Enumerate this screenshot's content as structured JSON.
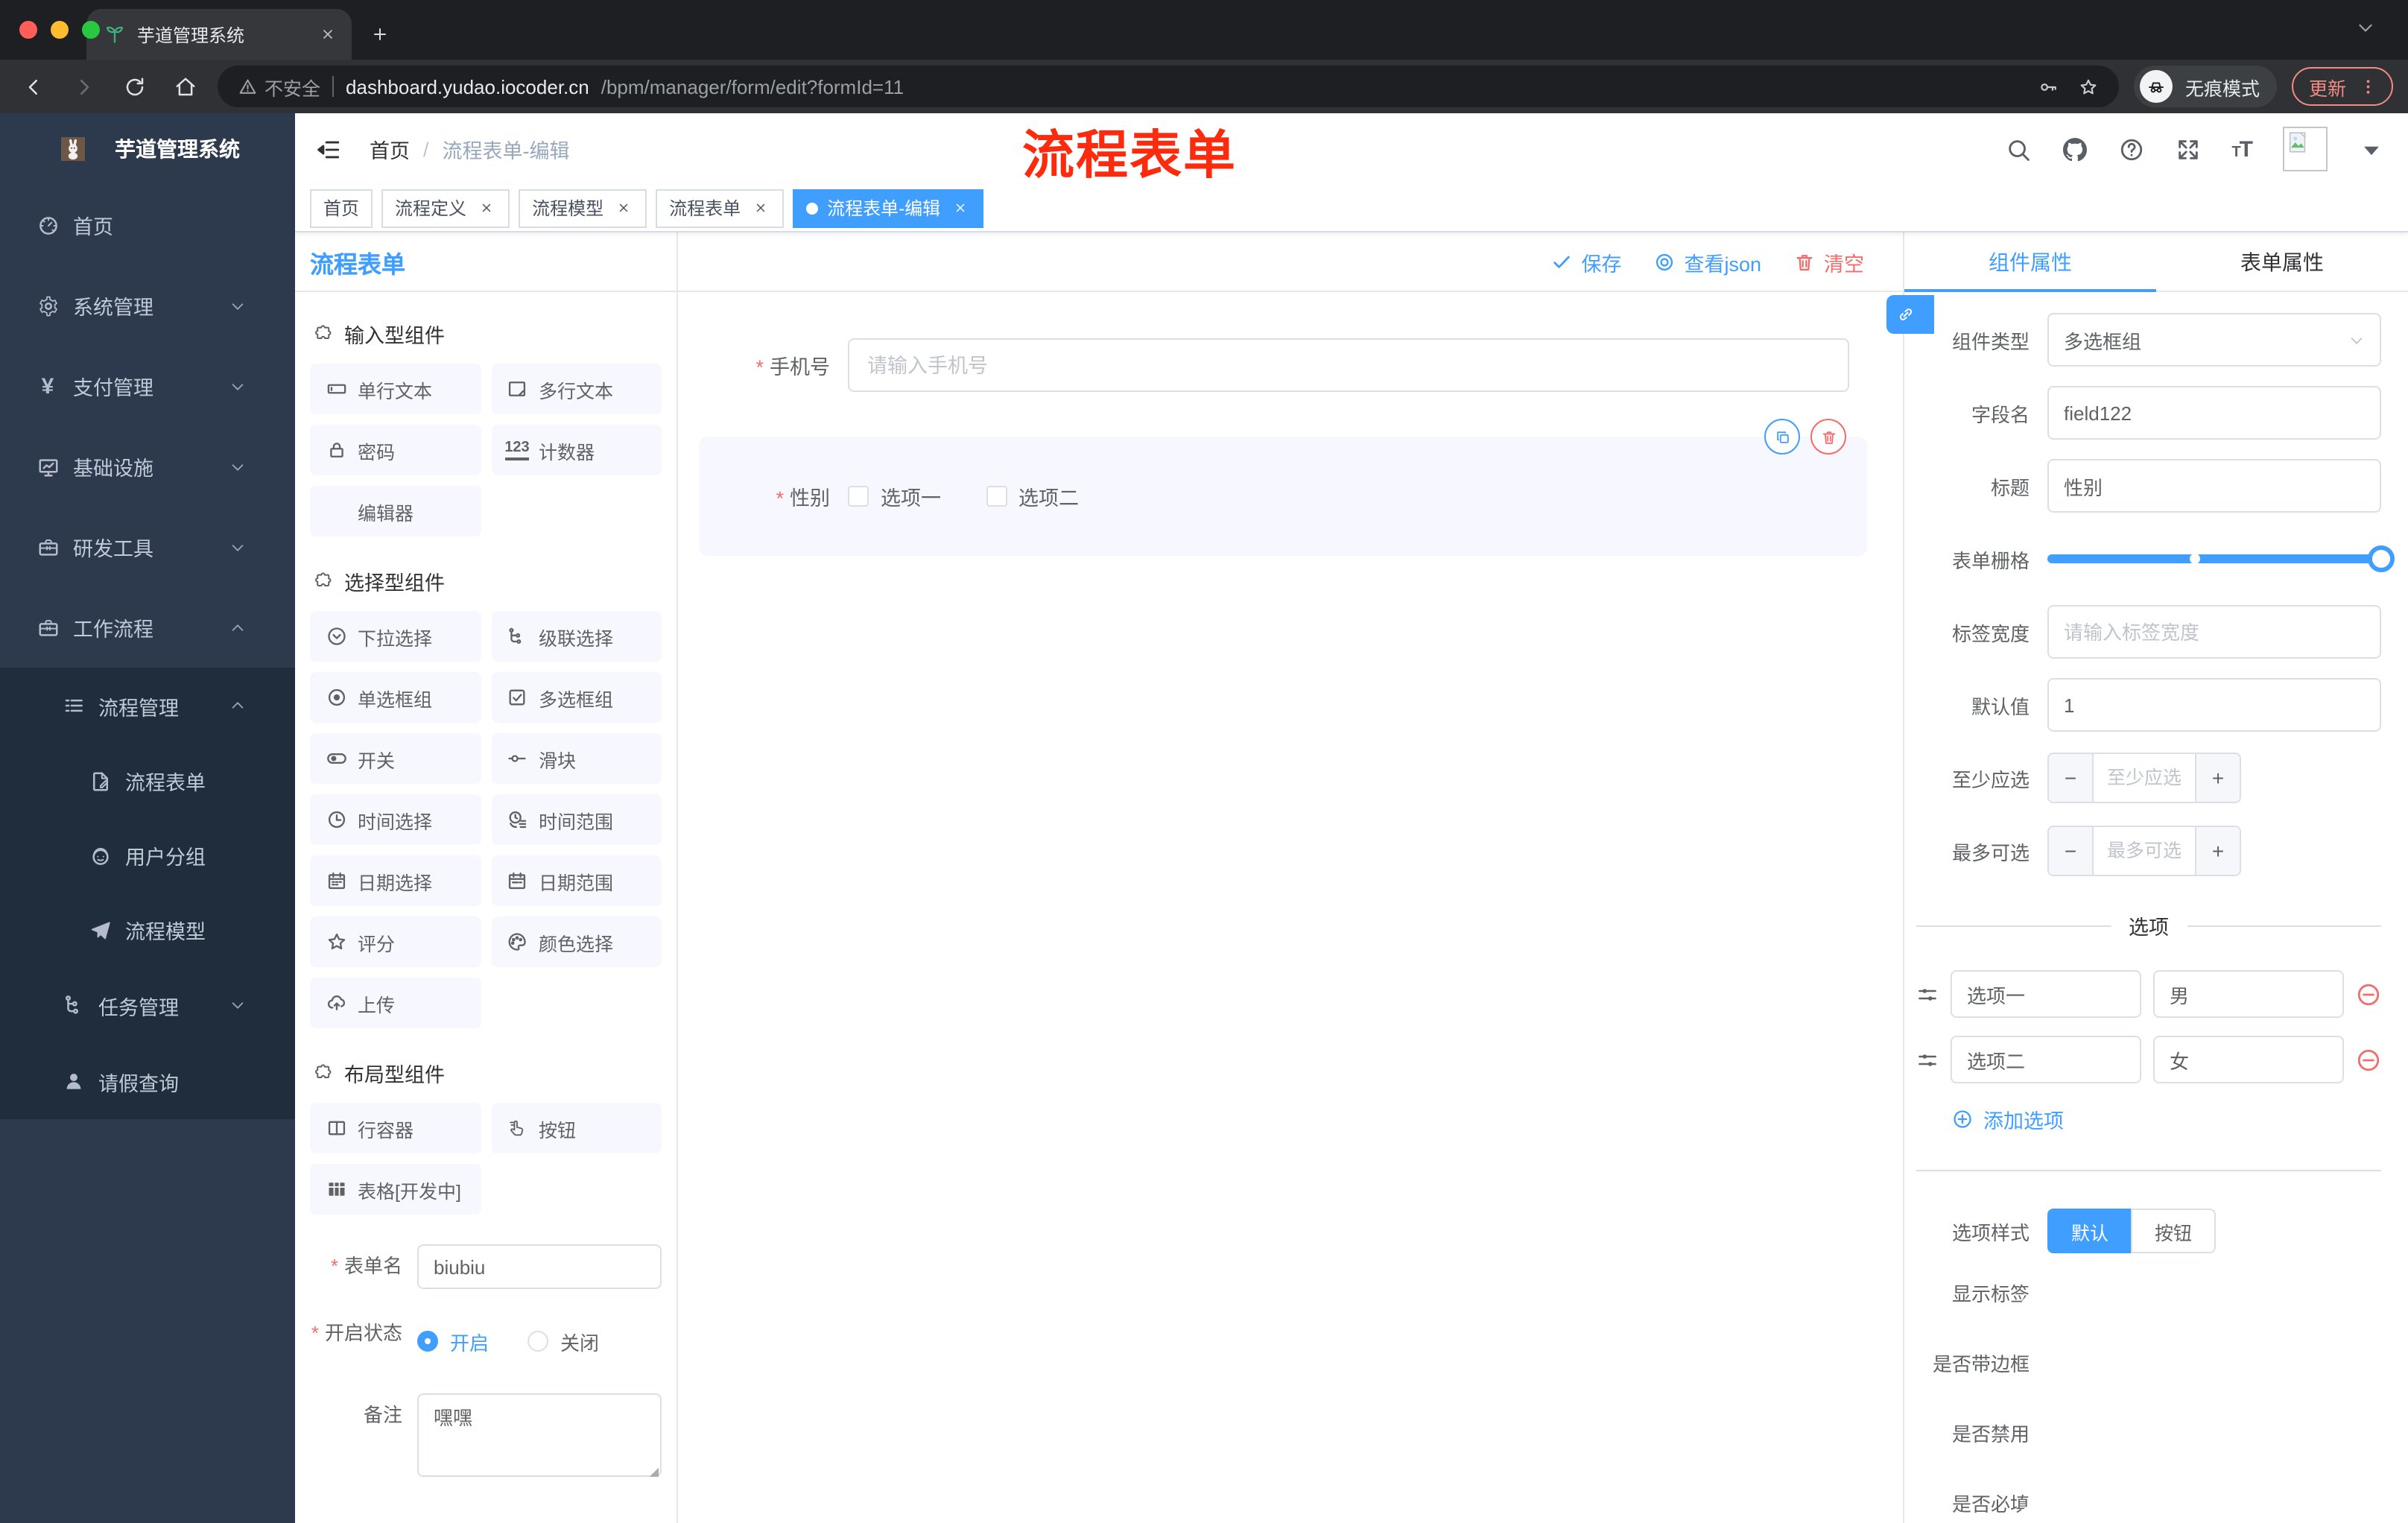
{
  "colors": {
    "primary": "#409eff",
    "danger": "#f56c6c",
    "annotation_red": "#fd2b0e",
    "sidebar_bg": "#2d3a4d",
    "submenu_bg": "#1f2d3d"
  },
  "browser": {
    "tab_title": "芋道管理系统",
    "security_label": "不安全",
    "url_domain": "dashboard.yudao.iocoder.cn",
    "url_path": "/bpm/manager/form/edit?formId=11",
    "incognito_label": "无痕模式",
    "update_label": "更新"
  },
  "sidebar": {
    "logo_title": "芋道管理系统",
    "items": [
      {
        "label": "首页",
        "icon": "dashboard-icon",
        "depth": 0,
        "chevron": ""
      },
      {
        "label": "系统管理",
        "icon": "gear-icon",
        "depth": 0,
        "chevron": "down"
      },
      {
        "label": "支付管理",
        "icon": "yen-icon",
        "depth": 0,
        "chevron": "down"
      },
      {
        "label": "基础设施",
        "icon": "monitor-icon",
        "depth": 0,
        "chevron": "down"
      },
      {
        "label": "研发工具",
        "icon": "briefcase-icon",
        "depth": 0,
        "chevron": "down"
      },
      {
        "label": "工作流程",
        "icon": "briefcase-icon",
        "depth": 0,
        "chevron": "up"
      },
      {
        "label": "流程管理",
        "icon": "list-icon",
        "depth": 1,
        "chevron": "up"
      },
      {
        "label": "流程表单",
        "icon": "doc-edit-icon",
        "depth": 2,
        "chevron": ""
      },
      {
        "label": "用户分组",
        "icon": "face-icon",
        "depth": 2,
        "chevron": ""
      },
      {
        "label": "流程模型",
        "icon": "send-icon",
        "depth": 2,
        "chevron": ""
      },
      {
        "label": "任务管理",
        "icon": "tree-icon",
        "depth": 1,
        "chevron": "down"
      },
      {
        "label": "请假查询",
        "icon": "user-icon",
        "depth": 1,
        "chevron": ""
      }
    ]
  },
  "navbar": {
    "breadcrumb": [
      "首页",
      "流程表单-编辑"
    ],
    "annotation": "流程表单"
  },
  "tags": [
    {
      "label": "首页",
      "closable": false,
      "active": false
    },
    {
      "label": "流程定义",
      "closable": true,
      "active": false
    },
    {
      "label": "流程模型",
      "closable": true,
      "active": false
    },
    {
      "label": "流程表单",
      "closable": true,
      "active": false
    },
    {
      "label": "流程表单-编辑",
      "closable": true,
      "active": true
    }
  ],
  "components_panel": {
    "title": "流程表单",
    "groups": [
      {
        "title": "输入型组件",
        "items": [
          {
            "label": "单行文本",
            "icon": "input-icon"
          },
          {
            "label": "多行文本",
            "icon": "textarea-icon"
          },
          {
            "label": "密码",
            "icon": "lock-icon"
          },
          {
            "label": "计数器",
            "icon": "counter-icon"
          },
          {
            "label": "编辑器",
            "icon": ""
          }
        ]
      },
      {
        "title": "选择型组件",
        "items": [
          {
            "label": "下拉选择",
            "icon": "select-icon"
          },
          {
            "label": "级联选择",
            "icon": "cascade-icon"
          },
          {
            "label": "单选框组",
            "icon": "radio-icon"
          },
          {
            "label": "多选框组",
            "icon": "checkbox-icon"
          },
          {
            "label": "开关",
            "icon": "switch-icon"
          },
          {
            "label": "滑块",
            "icon": "slider-icon"
          },
          {
            "label": "时间选择",
            "icon": "clock-icon"
          },
          {
            "label": "时间范围",
            "icon": "clock-range-icon"
          },
          {
            "label": "日期选择",
            "icon": "calendar-icon"
          },
          {
            "label": "日期范围",
            "icon": "calendar-range-icon"
          },
          {
            "label": "评分",
            "icon": "star-icon"
          },
          {
            "label": "颜色选择",
            "icon": "palette-icon"
          },
          {
            "label": "上传",
            "icon": "cloud-upload-icon"
          }
        ]
      },
      {
        "title": "布局型组件",
        "items": [
          {
            "label": "行容器",
            "icon": "columns-icon"
          },
          {
            "label": "按钮",
            "icon": "pointer-icon"
          },
          {
            "label": "表格[开发中]",
            "icon": "table-icon"
          }
        ]
      }
    ],
    "form": {
      "name_label": "表单名",
      "name_value": "biubiu",
      "status_label": "开启状态",
      "status_on": "开启",
      "status_off": "关闭",
      "remark_label": "备注",
      "remark_value": "嘿嘿"
    }
  },
  "toolbar": {
    "save_label": "保存",
    "view_json_label": "查看json",
    "clear_label": "清空"
  },
  "canvas": {
    "phone": {
      "label": "手机号",
      "placeholder": "请输入手机号"
    },
    "gender": {
      "label": "性别",
      "options": [
        "选项一",
        "选项二"
      ]
    }
  },
  "properties": {
    "tabs": [
      {
        "label": "组件属性",
        "active": true
      },
      {
        "label": "表单属性",
        "active": false
      }
    ],
    "component_type": {
      "label": "组件类型",
      "value": "多选框组"
    },
    "field_name": {
      "label": "字段名",
      "value": "field122"
    },
    "title": {
      "label": "标题",
      "value": "性别"
    },
    "grid": {
      "label": "表单栅格"
    },
    "label_width": {
      "label": "标签宽度",
      "placeholder": "请输入标签宽度"
    },
    "default_value": {
      "label": "默认值",
      "value": "1"
    },
    "min_select": {
      "label": "至少应选",
      "placeholder": "至少应选"
    },
    "max_select": {
      "label": "最多可选",
      "placeholder": "最多可选"
    },
    "options_divider": "选项",
    "options": [
      {
        "name": "选项一",
        "value": "男"
      },
      {
        "name": "选项二",
        "value": "女"
      }
    ],
    "add_option_label": "添加选项",
    "style": {
      "label": "选项样式",
      "options": [
        {
          "label": "默认",
          "active": true
        },
        {
          "label": "按钮",
          "active": false
        }
      ]
    },
    "switches": [
      {
        "label": "显示标签",
        "on": true
      },
      {
        "label": "是否带边框",
        "on": false
      },
      {
        "label": "是否禁用",
        "on": false
      },
      {
        "label": "是否必填",
        "on": true
      }
    ]
  }
}
